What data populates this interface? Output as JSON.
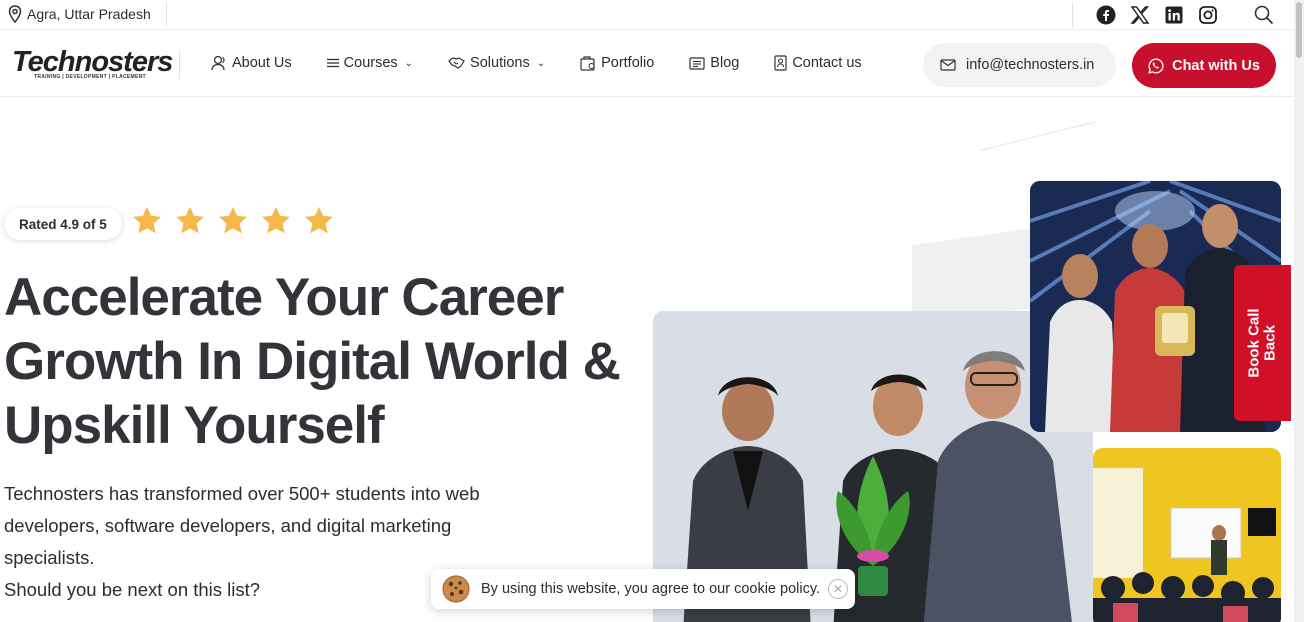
{
  "topbar": {
    "location": "Agra, Uttar Pradesh",
    "socials": [
      "facebook-icon",
      "x-twitter-icon",
      "linkedin-icon",
      "instagram-icon"
    ],
    "search_icon": "search-icon"
  },
  "nav": {
    "logo_text": "Technosters",
    "logo_tagline": "TRAINING | DEVELOPMENT | PLACEMENT",
    "items": [
      {
        "label": "About Us",
        "icon": "users-icon",
        "caret": false
      },
      {
        "label": "Courses",
        "icon": "list-icon",
        "caret": true
      },
      {
        "label": "Solutions",
        "icon": "handshake-icon",
        "caret": true
      },
      {
        "label": "Portfolio",
        "icon": "portfolio-icon",
        "caret": false
      },
      {
        "label": "Blog",
        "icon": "blog-icon",
        "caret": false
      },
      {
        "label": "Contact us",
        "icon": "contact-icon",
        "caret": false
      }
    ],
    "email": "info@technosters.in",
    "chat_label": "Chat with Us"
  },
  "hero": {
    "rating_label": "Rated 4.9 of 5",
    "stars": 5,
    "headline": "Accelerate Your Career Growth In Digital World & Upskill Yourself",
    "description": "Technosters has transformed over 500+ students into web developers, software developers, and digital marketing specialists.",
    "question": "Should you be next on this list?"
  },
  "side_tab": {
    "label": "Book Call\nBack"
  },
  "cookie": {
    "text": "By using this website, you agree to our cookie policy."
  },
  "colors": {
    "brand_red": "#c8102e",
    "star_yellow": "#f7b84b",
    "text_dark": "#33343a"
  }
}
